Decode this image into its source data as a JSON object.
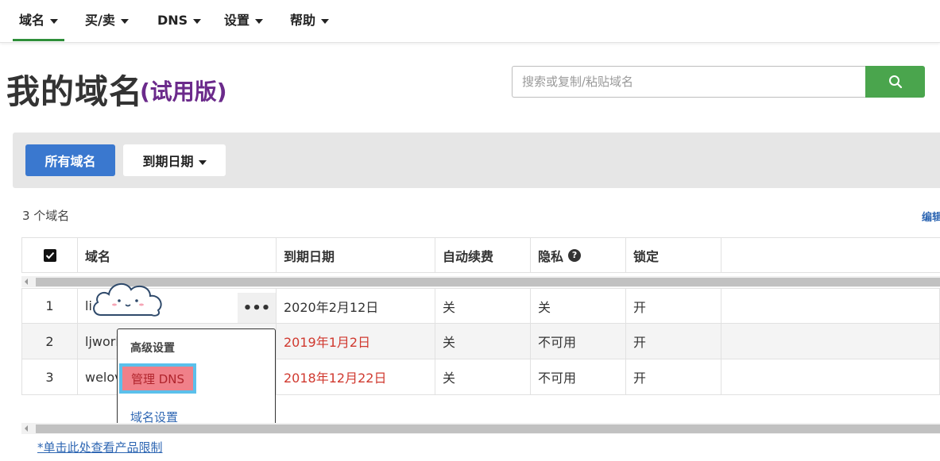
{
  "nav": {
    "items": [
      {
        "label": "域名",
        "active": true
      },
      {
        "label": "买/卖"
      },
      {
        "label": "DNS"
      },
      {
        "label": "设置"
      },
      {
        "label": "帮助"
      }
    ]
  },
  "page": {
    "title": "我的域名",
    "subtitle": "(试用版)"
  },
  "search": {
    "placeholder": "搜索或复制/粘贴域名",
    "button_icon": "search-icon"
  },
  "toolbar": {
    "all_label": "所有域名",
    "expiry_label": "到期日期"
  },
  "list": {
    "count_text": "3 个域名",
    "edit_label": "编辑",
    "columns": [
      "域名",
      "到期日期",
      "自动续费",
      "隐私",
      "锁定"
    ],
    "rows": [
      {
        "index": "1",
        "domain": "li",
        "expiry": "2020年2月12日",
        "expired": false,
        "auto_renew": "关",
        "privacy": "关",
        "lock": "开"
      },
      {
        "index": "2",
        "domain": "ljworl",
        "expiry": "2019年1月2日",
        "expired": true,
        "auto_renew": "关",
        "privacy": "不可用",
        "lock": "开"
      },
      {
        "index": "3",
        "domain": "welov",
        "expiry": "2018年12月22日",
        "expired": true,
        "auto_renew": "关",
        "privacy": "不可用",
        "lock": "开"
      }
    ]
  },
  "dropdown": {
    "header": "高级设置",
    "manage_dns": "管理 DNS",
    "domain_settings": "域名设置"
  },
  "footer": {
    "limits_link": "*单击此处查看产品限制"
  },
  "colors": {
    "brand_green": "#4aa54d",
    "primary_blue": "#3a78cf",
    "link_blue": "#2f67b3",
    "expired_red": "#d0392f",
    "trial_purple": "#6b2a8b"
  }
}
